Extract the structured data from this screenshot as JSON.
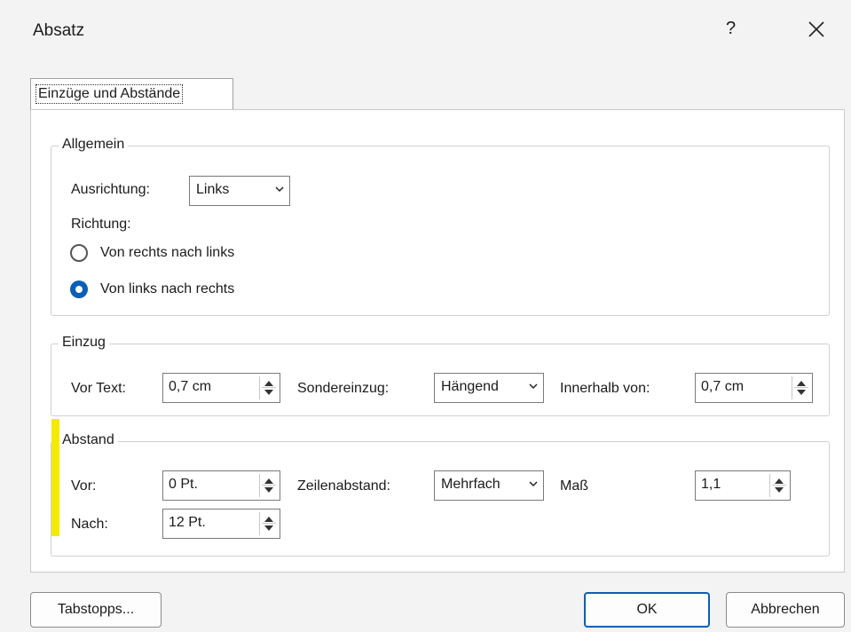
{
  "dialog": {
    "title": "Absatz",
    "help_label": "?",
    "tab_label": "Einzüge und Abstände"
  },
  "general": {
    "heading": "Allgemein",
    "alignment_label": "Ausrichtung:",
    "alignment_value": "Links",
    "direction_label": "Richtung:",
    "options": [
      {
        "label": "Von rechts nach links",
        "selected": false
      },
      {
        "label": "Von links nach rechts",
        "selected": true
      }
    ]
  },
  "indent": {
    "heading": "Einzug",
    "before_text_label": "Vor Text:",
    "before_text_value": "0,7 cm",
    "special_label": "Sondereinzug:",
    "special_value": "Hängend",
    "by_label": "Innerhalb von:",
    "by_value": "0,7 cm"
  },
  "spacing": {
    "heading": "Abstand",
    "before_label": "Vor:",
    "before_value": "0 Pt.",
    "after_label": "Nach:",
    "after_value": "12 Pt.",
    "line_spacing_label": "Zeilenabstand:",
    "line_spacing_value": "Mehrfach",
    "at_label": "Maß",
    "at_value": "1,1"
  },
  "footer": {
    "tabs_button": "Tabstopps...",
    "ok_button": "OK",
    "cancel_button": "Abbrechen"
  },
  "colors": {
    "accent": "#0a5fb4",
    "highlight": "#f4ea00"
  }
}
